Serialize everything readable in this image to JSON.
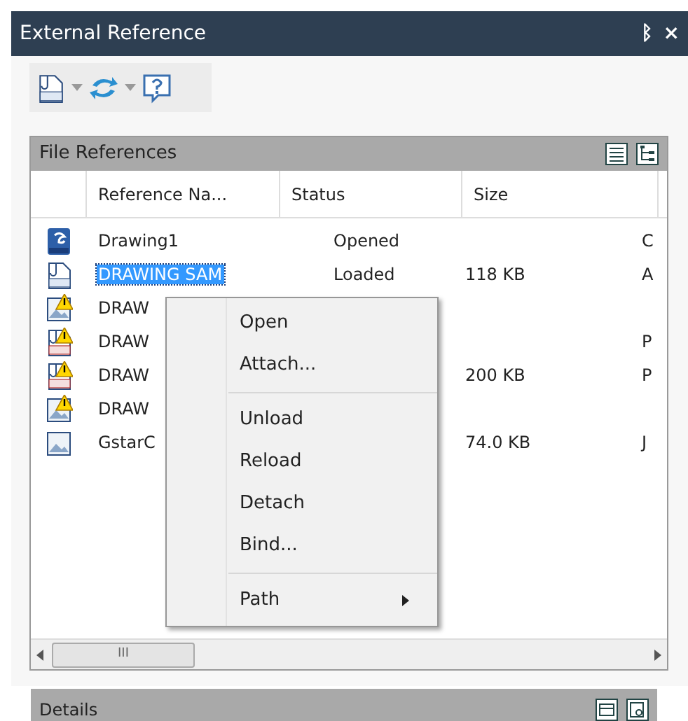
{
  "window": {
    "title": "External Reference"
  },
  "title_buttons": [
    "ᛒ",
    "×"
  ],
  "file_references": {
    "title": "File References",
    "columns": [
      "Reference Na...",
      "Status",
      "Size"
    ],
    "rows": [
      {
        "kind": "drawing",
        "warning": false,
        "selected": false,
        "name": "Drawing1",
        "status": "Opened",
        "size": "",
        "column_4": "C"
      },
      {
        "kind": "dwg",
        "warning": false,
        "selected": true,
        "name": "DRAWING SAM",
        "status": "Loaded",
        "size": "118 KB",
        "column_4": "A"
      },
      {
        "kind": "image",
        "warning": true,
        "selected": false,
        "name": "DRAW",
        "status": "",
        "size": "",
        "column_4": ""
      },
      {
        "kind": "pdf",
        "warning": true,
        "selected": false,
        "name": "DRAW",
        "status": "",
        "size": "",
        "column_4": "P"
      },
      {
        "kind": "pdf",
        "warning": true,
        "selected": false,
        "name": "DRAW",
        "status": "",
        "size": "200 KB",
        "column_4": "P"
      },
      {
        "kind": "image",
        "warning": true,
        "selected": false,
        "name": "DRAW",
        "status": "",
        "size": "",
        "column_4": ""
      },
      {
        "kind": "image",
        "warning": false,
        "selected": false,
        "name": "GstarC",
        "status": "",
        "size": "74.0 KB",
        "column_4": "J"
      }
    ],
    "scroll_grip": "III"
  },
  "context_menu": [
    {
      "kind": "item",
      "label": "Open",
      "submenu": false
    },
    {
      "kind": "item",
      "label": "Attach...",
      "submenu": false
    },
    {
      "kind": "separator"
    },
    {
      "kind": "item",
      "label": "Unload",
      "submenu": false
    },
    {
      "kind": "item",
      "label": "Reload",
      "submenu": false
    },
    {
      "kind": "item",
      "label": "Detach",
      "submenu": false
    },
    {
      "kind": "item",
      "label": "Bind...",
      "submenu": false
    },
    {
      "kind": "separator"
    },
    {
      "kind": "item",
      "label": "Path",
      "submenu": true
    }
  ],
  "details": {
    "title": "Details"
  }
}
